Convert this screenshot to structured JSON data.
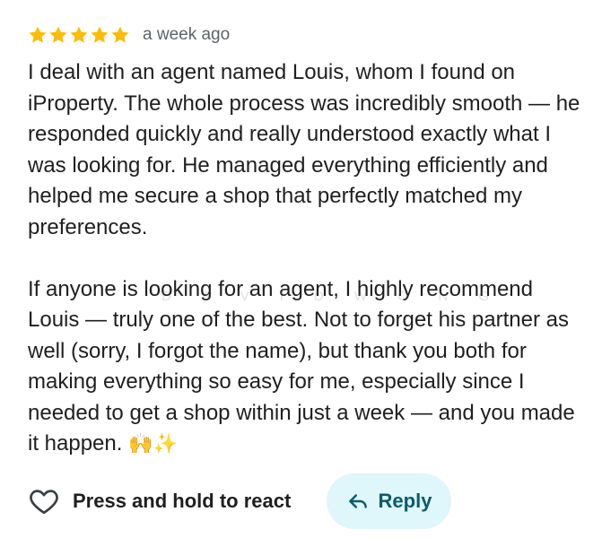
{
  "review": {
    "rating": 5,
    "rating_max": 5,
    "star_color": "#fbbc04",
    "time_ago": "a week ago",
    "paragraph_1": "I deal with an agent named Louis, whom I found on iProperty. The whole process was incredibly smooth — he responded quickly and really understood exactly what I was looking for. He managed everything efficiently and helped me secure a shop that perfectly matched my preferences.",
    "paragraph_2": "If anyone is looking for an agent, I highly recommend Louis — truly one of the best. Not to forget his partner as well (sorry, I forgot the name), but thank you both for making everything so easy for me, especially since I needed to get a shop within just a week — and you made it happen.",
    "emoji_1": "🙌",
    "emoji_2": "✨"
  },
  "watermark": "DAVIDWONG",
  "actions": {
    "react_label": "Press and hold to react",
    "react_icon": "heart-outline-icon",
    "reply_label": "Reply",
    "reply_icon": "reply-arrow-icon",
    "reply_bg": "#dff6fa",
    "reply_text_color": "#0b5b6a"
  }
}
